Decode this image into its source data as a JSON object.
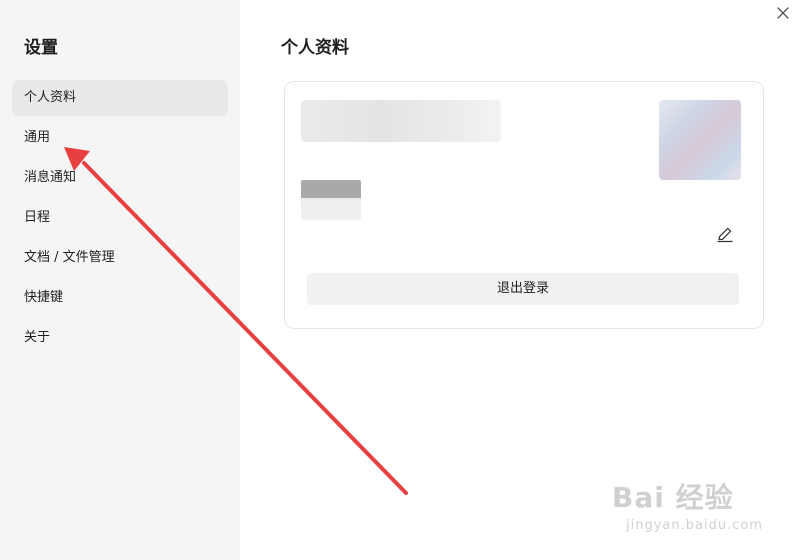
{
  "sidebar": {
    "title": "设置",
    "items": [
      {
        "label": "个人资料",
        "active": true
      },
      {
        "label": "通用"
      },
      {
        "label": "消息通知"
      },
      {
        "label": "日程"
      },
      {
        "label": "文档 / 文件管理"
      },
      {
        "label": "快捷键"
      },
      {
        "label": "关于"
      }
    ]
  },
  "main": {
    "title": "个人资料",
    "profile_card": {
      "logout_label": "退出登录",
      "edit_icon": "pencil-icon",
      "avatar": "blurred-avatar"
    }
  },
  "window": {
    "close_icon": "close-icon"
  },
  "annotation": {
    "arrow_color": "#e84040",
    "points_to": "通用"
  },
  "watermark": {
    "line1": "Bai 经验",
    "line2": "jingyan.baidu.com"
  },
  "colors": {
    "sidebar_bg": "#f5f5f5",
    "active_item_bg": "#e9e9e9",
    "button_bg": "#f1f1f1",
    "card_border": "#e7e7e7"
  }
}
